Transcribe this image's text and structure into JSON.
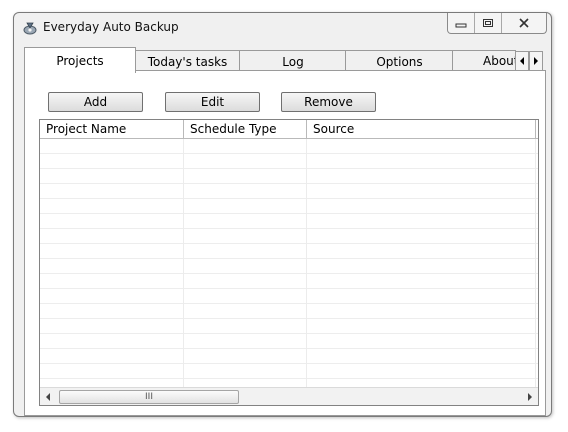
{
  "window": {
    "title": "Everyday Auto Backup"
  },
  "titlebar_buttons": {
    "minimize": "minimize-icon",
    "restore": "restore-icon",
    "close": "close-icon"
  },
  "tabs": [
    {
      "label": "Projects",
      "active": true
    },
    {
      "label": "Today's tasks",
      "active": false
    },
    {
      "label": "Log",
      "active": false
    },
    {
      "label": "Options",
      "active": false
    },
    {
      "label": "About",
      "active": false
    }
  ],
  "toolbar": {
    "add_label": "Add",
    "edit_label": "Edit",
    "remove_label": "Remove"
  },
  "list": {
    "columns": [
      "Project Name",
      "Schedule Type",
      "Source"
    ],
    "rows": []
  },
  "scrollbar": {
    "thumb_grip": "III"
  }
}
